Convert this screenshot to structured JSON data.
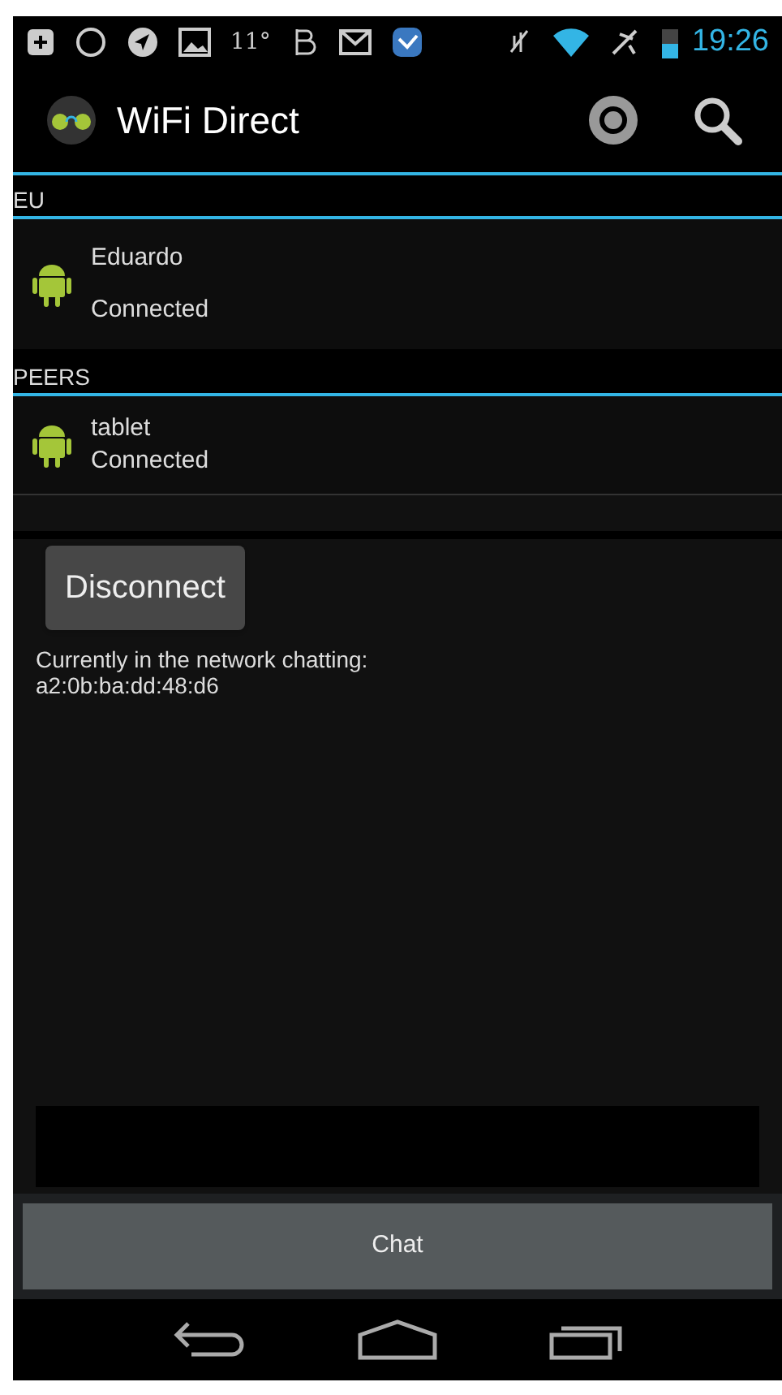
{
  "status_bar": {
    "temperature": "11°",
    "time": "19:26"
  },
  "action_bar": {
    "title": "WiFi Direct"
  },
  "sections": [
    {
      "header": "EU",
      "devices": [
        {
          "name": "Eduardo",
          "status": "Connected"
        }
      ]
    },
    {
      "header": "PEERS",
      "devices": [
        {
          "name": "tablet",
          "status": "Connected"
        }
      ]
    }
  ],
  "disconnect_button": "Disconnect",
  "network_info": [
    "Currently in the network chatting:",
    "a2:0b:ba:dd:48:d6"
  ],
  "chat_button": "Chat"
}
